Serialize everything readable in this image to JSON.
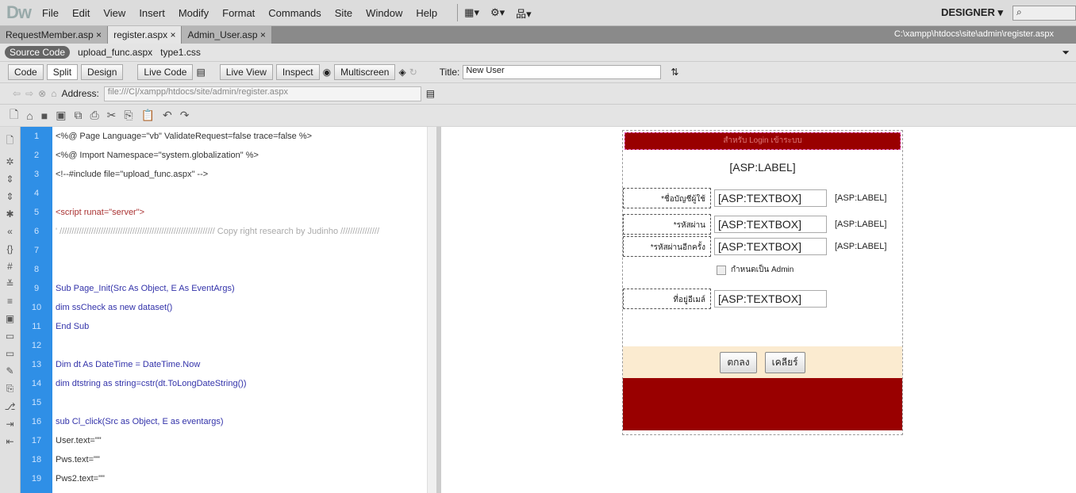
{
  "app": {
    "logo": "Dw",
    "menu": [
      "File",
      "Edit",
      "View",
      "Insert",
      "Modify",
      "Format",
      "Commands",
      "Site",
      "Window",
      "Help"
    ],
    "workspace": "DESIGNER ▾",
    "search_placeholder": "⌕"
  },
  "tabs": [
    {
      "label": "RequestMember.asp ×"
    },
    {
      "label": "register.aspx ×"
    },
    {
      "label": "Admin_User.asp ×"
    }
  ],
  "path": "C:\\xampp\\htdocs\\site\\admin\\register.aspx",
  "related": [
    "Source Code",
    "upload_func.aspx",
    "type1.css"
  ],
  "toolbar": {
    "code": "Code",
    "split": "Split",
    "design": "Design",
    "live_code": "Live Code",
    "live_view": "Live View",
    "inspect": "Inspect",
    "multiscreen": "Multiscreen",
    "title_label": "Title:",
    "title_value": "New User"
  },
  "address": {
    "label": "Address:",
    "value": "file:///C|/xampp/htdocs/site/admin/register.aspx"
  },
  "code_lines": [
    "<%@ Page Language=\"vb\" ValidateRequest=false trace=false %>",
    "<%@ Import Namespace=\"system.globalization\" %>",
    "<!--#include file=\"upload_func.aspx\" -->",
    "",
    "<script runat=\"server\">",
    "' ////////////////////////////////////////////////////////////////  Copy  right  research  by  Judinho ////////////////",
    "",
    "",
    "Sub Page_Init(Src As Object, E As EventArgs)",
    "dim ssCheck as new dataset()",
    "End Sub",
    "",
    " Dim dt As DateTime = DateTime.Now",
    " dim dtstring as string=cstr(dt.ToLongDateString())",
    "",
    "  sub Cl_click(Src as Object, E as eventargs)",
    "   User.text=\"\"",
    "   Pws.text=\"\"",
    "   Pws2.text=\"\""
  ],
  "form": {
    "header": "สำหรับ Login เข้าระบบ",
    "label": "[ASP:LABEL]",
    "rows": [
      {
        "label": "*ชื่อบัญชีผู้ใช้",
        "box": "[ASP:TEXTBOX]",
        "msg": "[ASP:LABEL]"
      },
      {
        "label": "*รหัสผ่าน",
        "box": "[ASP:TEXTBOX]",
        "msg": "[ASP:LABEL]"
      },
      {
        "label": "*รหัสผ่านอีกครั้ง",
        "box": "[ASP:TEXTBOX]",
        "msg": "[ASP:LABEL]"
      },
      {
        "label": "ที่อยู่อีเมล์",
        "box": "[ASP:TEXTBOX]"
      }
    ],
    "admin_check": "กำหนดเป็น Admin",
    "ok": "ตกลง",
    "clear": "เคลียร์"
  }
}
